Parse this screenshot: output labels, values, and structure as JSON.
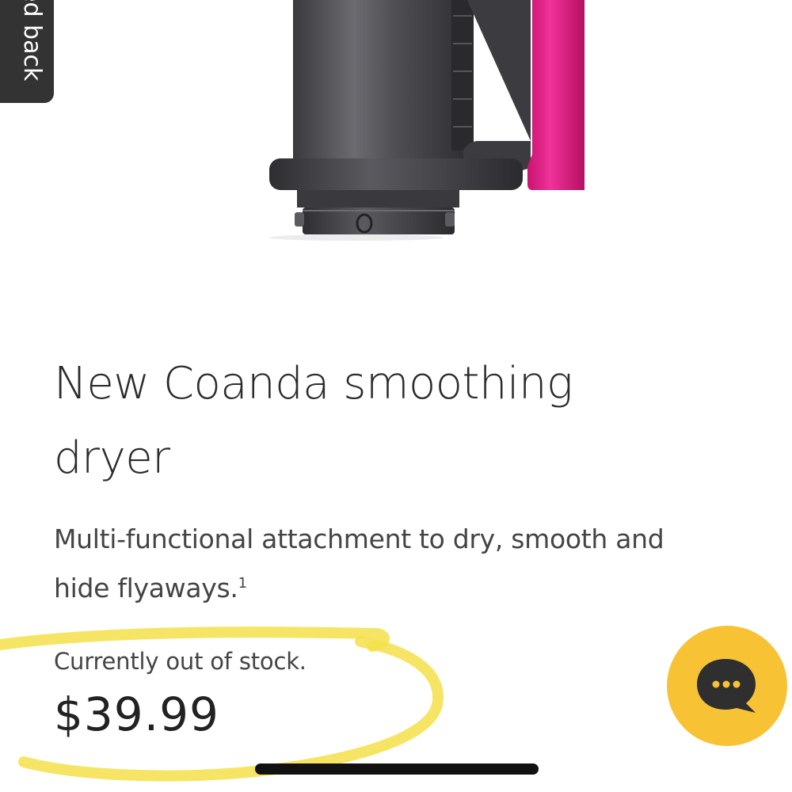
{
  "feedback_tab": {
    "label": "ed back"
  },
  "product": {
    "title": "New Coanda smoothing dryer",
    "description": "Multi-functional attachment to dry, smooth and hide flyaways.",
    "description_footnote": "1",
    "stock_status": "Currently out of stock.",
    "price": "$39.99",
    "image_icon": "hair-dryer-attachment-image"
  },
  "chat": {
    "icon": "chat-bubble-icon"
  },
  "colors": {
    "accent_yellow": "#f7c335",
    "highlighter": "#f5e14a",
    "attachment_body": "#4a4a4e",
    "attachment_pink": "#e6218a",
    "text_dark": "#2b2b2b"
  }
}
